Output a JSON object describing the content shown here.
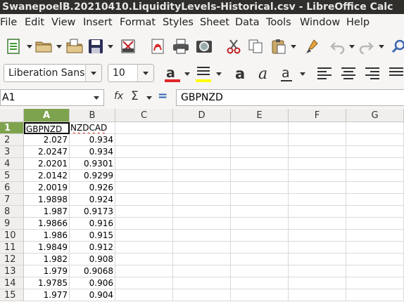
{
  "window": {
    "title": "SwanepoelB.20210410.LiquidityLevels-Historical.csv - LibreOffice Calc"
  },
  "menu": [
    "File",
    "Edit",
    "View",
    "Insert",
    "Format",
    "Styles",
    "Sheet",
    "Data",
    "Tools",
    "Window",
    "Help"
  ],
  "toolbar": {
    "icons": [
      "new-icon",
      "open-icon",
      "templates-icon",
      "save-icon",
      "print-preview-icon",
      "export-pdf-icon",
      "print-icon",
      "find-icon",
      "cut-icon",
      "copy-icon",
      "paste-icon",
      "clone-formatting-icon",
      "undo-icon",
      "redo-icon",
      "search-icon"
    ]
  },
  "formatting": {
    "font_name": "Liberation Sans",
    "font_size": "10",
    "font_color": "#e0252a",
    "highlight_color": "#ffff00"
  },
  "formula_bar": {
    "name_box": "A1",
    "function_wizard": "fx",
    "sum_symbol": "Σ",
    "equals_symbol": "=",
    "content": "GBPNZD"
  },
  "sheet": {
    "columns": [
      "A",
      "B",
      "C",
      "D",
      "E",
      "F",
      "G"
    ],
    "selected_column": "A",
    "selected_row": "1",
    "rows": [
      {
        "n": "1",
        "a": "GBPNZD",
        "b": "NZDCAD"
      },
      {
        "n": "2",
        "a": "2.027",
        "b": "0.934"
      },
      {
        "n": "3",
        "a": "2.0247",
        "b": "0.934"
      },
      {
        "n": "4",
        "a": "2.0201",
        "b": "0.9301"
      },
      {
        "n": "5",
        "a": "2.0142",
        "b": "0.9299"
      },
      {
        "n": "6",
        "a": "2.0019",
        "b": "0.926"
      },
      {
        "n": "7",
        "a": "1.9898",
        "b": "0.924"
      },
      {
        "n": "8",
        "a": "1.987",
        "b": "0.9173"
      },
      {
        "n": "9",
        "a": "1.9866",
        "b": "0.916"
      },
      {
        "n": "10",
        "a": "1.986",
        "b": "0.915"
      },
      {
        "n": "11",
        "a": "1.9849",
        "b": "0.912"
      },
      {
        "n": "12",
        "a": "1.982",
        "b": "0.908"
      },
      {
        "n": "13",
        "a": "1.979",
        "b": "0.9068"
      },
      {
        "n": "14",
        "a": "1.9785",
        "b": "0.906"
      },
      {
        "n": "15",
        "a": "1.977",
        "b": "0.904"
      }
    ]
  }
}
